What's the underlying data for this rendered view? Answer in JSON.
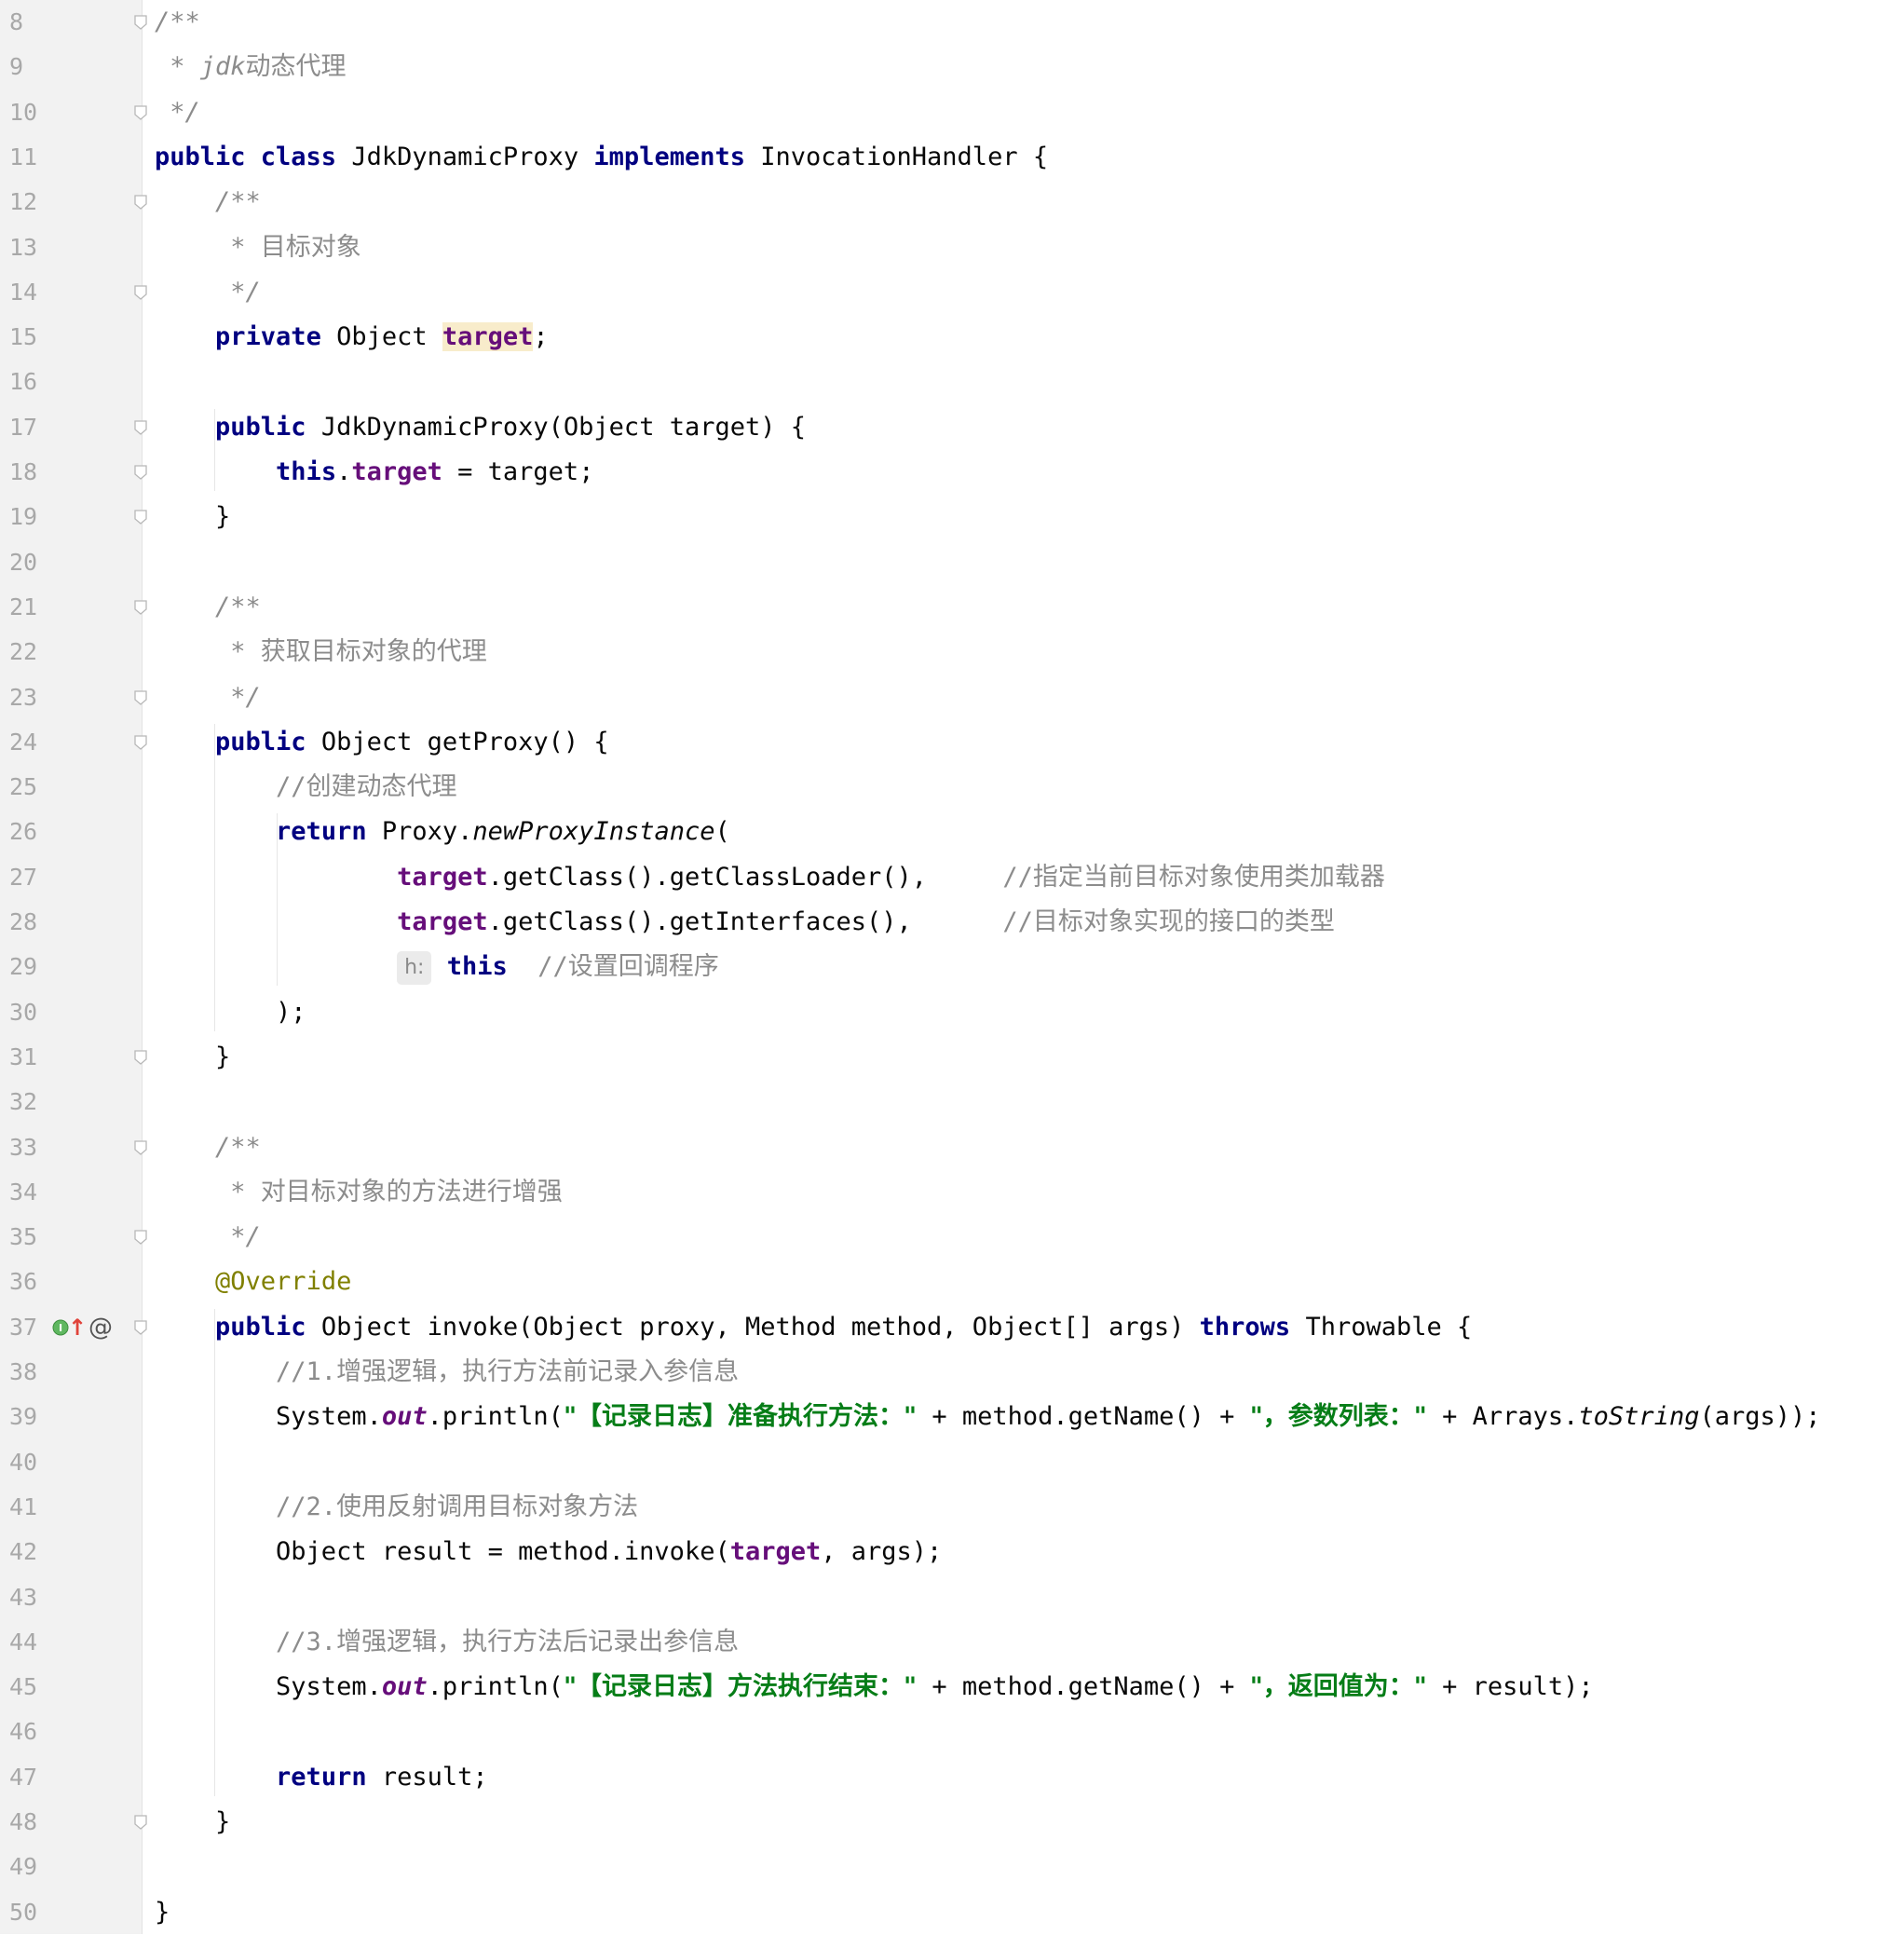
{
  "editor": {
    "language": "java",
    "lines": [
      {
        "n": "8",
        "tokens": [
          {
            "t": "/**",
            "c": "doc"
          }
        ]
      },
      {
        "n": "9",
        "tokens": [
          {
            "t": " * jdk",
            "c": "doc"
          },
          {
            "t": "动态代理",
            "c": "comment cjk"
          }
        ]
      },
      {
        "n": "10",
        "tokens": [
          {
            "t": " */",
            "c": "doc"
          }
        ]
      },
      {
        "n": "11",
        "tokens": [
          {
            "t": "public class ",
            "c": "kw"
          },
          {
            "t": "JdkDynamicProxy ",
            "c": ""
          },
          {
            "t": "implements ",
            "c": "kw"
          },
          {
            "t": "InvocationHandler {",
            "c": ""
          }
        ]
      },
      {
        "n": "12",
        "tokens": [
          {
            "t": "    /**",
            "c": "doc"
          }
        ]
      },
      {
        "n": "13",
        "tokens": [
          {
            "t": "     * ",
            "c": "doc"
          },
          {
            "t": "目标对象",
            "c": "comment cjk"
          }
        ]
      },
      {
        "n": "14",
        "tokens": [
          {
            "t": "     */",
            "c": "doc"
          }
        ]
      },
      {
        "n": "15",
        "tokens": [
          {
            "t": "    ",
            "c": ""
          },
          {
            "t": "private ",
            "c": "kw"
          },
          {
            "t": "Object ",
            "c": ""
          },
          {
            "t": "target",
            "c": "field highlight"
          },
          {
            "t": ";",
            "c": ""
          }
        ]
      },
      {
        "n": "16",
        "tokens": []
      },
      {
        "n": "17",
        "tokens": [
          {
            "t": "    ",
            "c": ""
          },
          {
            "t": "public ",
            "c": "kw"
          },
          {
            "t": "JdkDynamicProxy(Object target) {",
            "c": ""
          }
        ]
      },
      {
        "n": "18",
        "tokens": [
          {
            "t": "        ",
            "c": ""
          },
          {
            "t": "this",
            "c": "kw"
          },
          {
            "t": ".",
            "c": ""
          },
          {
            "t": "target",
            "c": "field"
          },
          {
            "t": " = target;",
            "c": ""
          }
        ]
      },
      {
        "n": "19",
        "tokens": [
          {
            "t": "    }",
            "c": ""
          }
        ]
      },
      {
        "n": "20",
        "tokens": []
      },
      {
        "n": "21",
        "tokens": [
          {
            "t": "    /**",
            "c": "doc"
          }
        ]
      },
      {
        "n": "22",
        "tokens": [
          {
            "t": "     * ",
            "c": "doc"
          },
          {
            "t": "获取目标对象的代理",
            "c": "comment cjk"
          }
        ]
      },
      {
        "n": "23",
        "tokens": [
          {
            "t": "     */",
            "c": "doc"
          }
        ]
      },
      {
        "n": "24",
        "tokens": [
          {
            "t": "    ",
            "c": ""
          },
          {
            "t": "public ",
            "c": "kw"
          },
          {
            "t": "Object getProxy() {",
            "c": ""
          }
        ]
      },
      {
        "n": "25",
        "tokens": [
          {
            "t": "        //",
            "c": "comment"
          },
          {
            "t": "创建动态代理",
            "c": "comment cjk"
          }
        ]
      },
      {
        "n": "26",
        "tokens": [
          {
            "t": "        ",
            "c": ""
          },
          {
            "t": "return ",
            "c": "kw"
          },
          {
            "t": "Proxy.",
            "c": ""
          },
          {
            "t": "newProxyInstance",
            "c": "static"
          },
          {
            "t": "(",
            "c": ""
          }
        ]
      },
      {
        "n": "27",
        "tokens": [
          {
            "t": "                ",
            "c": ""
          },
          {
            "t": "target",
            "c": "field"
          },
          {
            "t": ".getClass().getClassLoader(),     ",
            "c": ""
          },
          {
            "t": "//",
            "c": "comment"
          },
          {
            "t": "指定当前目标对象使用类加载器",
            "c": "comment cjk"
          }
        ]
      },
      {
        "n": "28",
        "tokens": [
          {
            "t": "                ",
            "c": ""
          },
          {
            "t": "target",
            "c": "field"
          },
          {
            "t": ".getClass().getInterfaces(),      ",
            "c": ""
          },
          {
            "t": "//",
            "c": "comment"
          },
          {
            "t": "目标对象实现的接口的类型",
            "c": "comment cjk"
          }
        ]
      },
      {
        "n": "29",
        "tokens": [
          {
            "t": "                ",
            "c": ""
          },
          {
            "t": "h:",
            "c": "hint"
          },
          {
            "t": " ",
            "c": ""
          },
          {
            "t": "this",
            "c": "kw"
          },
          {
            "t": "  //",
            "c": "comment"
          },
          {
            "t": "设置回调程序",
            "c": "comment cjk"
          }
        ]
      },
      {
        "n": "30",
        "tokens": [
          {
            "t": "        );",
            "c": ""
          }
        ]
      },
      {
        "n": "31",
        "tokens": [
          {
            "t": "    }",
            "c": ""
          }
        ]
      },
      {
        "n": "32",
        "tokens": []
      },
      {
        "n": "33",
        "tokens": [
          {
            "t": "    /**",
            "c": "doc"
          }
        ]
      },
      {
        "n": "34",
        "tokens": [
          {
            "t": "     * ",
            "c": "doc"
          },
          {
            "t": "对目标对象的方法进行增强",
            "c": "comment cjk"
          }
        ]
      },
      {
        "n": "35",
        "tokens": [
          {
            "t": "     */",
            "c": "doc"
          }
        ]
      },
      {
        "n": "36",
        "tokens": [
          {
            "t": "    ",
            "c": ""
          },
          {
            "t": "@Override",
            "c": "annot"
          }
        ]
      },
      {
        "n": "37",
        "tokens": [
          {
            "t": "    ",
            "c": ""
          },
          {
            "t": "public ",
            "c": "kw"
          },
          {
            "t": "Object invoke(Object proxy, Method method, Object[] args) ",
            "c": ""
          },
          {
            "t": "throws ",
            "c": "kw"
          },
          {
            "t": "Throwable {",
            "c": ""
          }
        ]
      },
      {
        "n": "38",
        "tokens": [
          {
            "t": "        //1.",
            "c": "comment"
          },
          {
            "t": "增强逻辑，执行方法前记录入参信息",
            "c": "comment cjk"
          }
        ]
      },
      {
        "n": "39",
        "tokens": [
          {
            "t": "        System.",
            "c": ""
          },
          {
            "t": "out",
            "c": "static-field"
          },
          {
            "t": ".println(",
            "c": ""
          },
          {
            "t": "\"【记录日志】准备执行方法：\"",
            "c": "str cjk"
          },
          {
            "t": " + method.getName() + ",
            "c": ""
          },
          {
            "t": "\"，参数列表：\"",
            "c": "str cjk"
          },
          {
            "t": " + Arrays.",
            "c": ""
          },
          {
            "t": "toString",
            "c": "static"
          },
          {
            "t": "(args));",
            "c": ""
          }
        ]
      },
      {
        "n": "40",
        "tokens": []
      },
      {
        "n": "41",
        "tokens": [
          {
            "t": "        //2.",
            "c": "comment"
          },
          {
            "t": "使用反射调用目标对象方法",
            "c": "comment cjk"
          }
        ]
      },
      {
        "n": "42",
        "tokens": [
          {
            "t": "        Object result = method.invoke(",
            "c": ""
          },
          {
            "t": "target",
            "c": "field"
          },
          {
            "t": ", args);",
            "c": ""
          }
        ]
      },
      {
        "n": "43",
        "tokens": []
      },
      {
        "n": "44",
        "tokens": [
          {
            "t": "        //3.",
            "c": "comment"
          },
          {
            "t": "增强逻辑，执行方法后记录出参信息",
            "c": "comment cjk"
          }
        ]
      },
      {
        "n": "45",
        "tokens": [
          {
            "t": "        System.",
            "c": ""
          },
          {
            "t": "out",
            "c": "static-field"
          },
          {
            "t": ".println(",
            "c": ""
          },
          {
            "t": "\"【记录日志】方法执行结束：\"",
            "c": "str cjk"
          },
          {
            "t": " + method.getName() + ",
            "c": ""
          },
          {
            "t": "\"，返回值为：\"",
            "c": "str cjk"
          },
          {
            "t": " + result);",
            "c": ""
          }
        ]
      },
      {
        "n": "46",
        "tokens": []
      },
      {
        "n": "47",
        "tokens": [
          {
            "t": "        ",
            "c": ""
          },
          {
            "t": "return ",
            "c": "kw"
          },
          {
            "t": "result;",
            "c": ""
          }
        ]
      },
      {
        "n": "48",
        "tokens": [
          {
            "t": "    }",
            "c": ""
          }
        ]
      },
      {
        "n": "49",
        "tokens": []
      },
      {
        "n": "50",
        "tokens": [
          {
            "t": "}",
            "c": ""
          }
        ]
      }
    ],
    "gutter_icons": {
      "implements_marker": "I",
      "override_arrow": "↑",
      "annotation_at": "@"
    },
    "colors": {
      "keyword": "#000080",
      "field": "#660e7a",
      "string": "#067d17",
      "comment": "#8c8c8c",
      "annotation": "#808000",
      "gutter_bg": "#f2f2f2",
      "highlight_bg": "#f8eccb"
    }
  }
}
